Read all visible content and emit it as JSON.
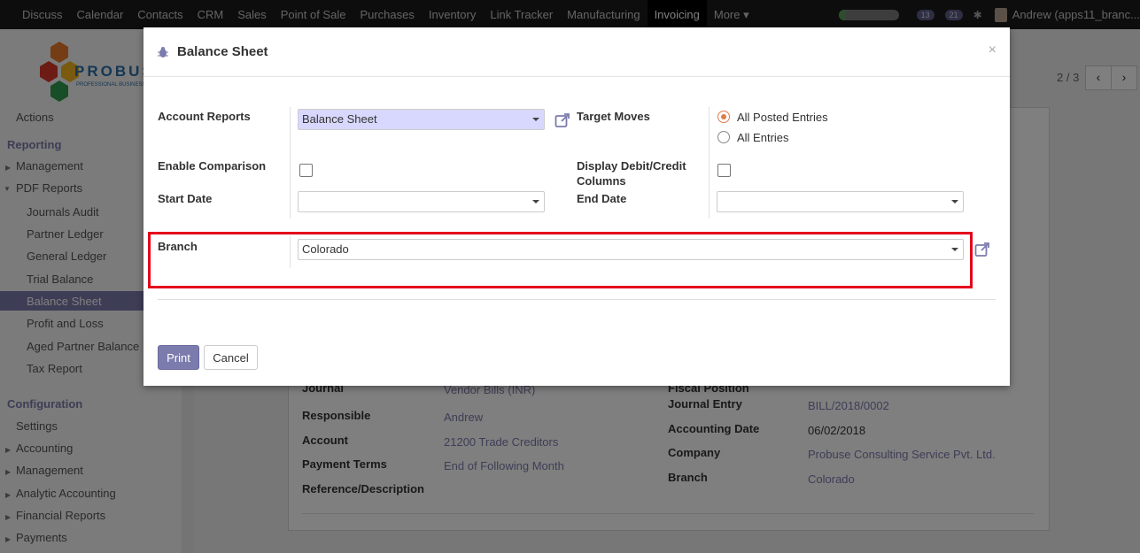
{
  "topbar": {
    "menu": [
      "Discuss",
      "Calendar",
      "Contacts",
      "CRM",
      "Sales",
      "Point of Sale",
      "Purchases",
      "Inventory",
      "Link Tracker",
      "Manufacturing",
      "Invoicing",
      "More ▾"
    ],
    "active": "Invoicing",
    "badge1": "13",
    "badge2": "21",
    "user": "Andrew (apps11_branc..."
  },
  "pager": {
    "text": "2 / 3",
    "prev": "‹",
    "next": "›"
  },
  "logo": {
    "text": "PROBUS",
    "tagline": "PROFESSIONAL BUSINESS"
  },
  "sidebar": {
    "actions": "Actions",
    "reporting": "Reporting",
    "management": "Management",
    "pdf_reports": "PDF Reports",
    "journals_audit": "Journals Audit",
    "partner_ledger": "Partner Ledger",
    "general_ledger": "General Ledger",
    "trial_balance": "Trial Balance",
    "balance_sheet": "Balance Sheet",
    "profit_loss": "Profit and Loss",
    "aged_partner": "Aged Partner Balance",
    "tax_report": "Tax Report",
    "configuration": "Configuration",
    "settings": "Settings",
    "accounting": "Accounting",
    "management2": "Management",
    "analytic": "Analytic Accounting",
    "financial": "Financial Reports",
    "payments": "Payments"
  },
  "background_form": {
    "journal_label": "Journal",
    "journal_value": "Vendor Bills (INR)",
    "fiscal_label": "Fiscal Position",
    "responsible_label": "Responsible",
    "responsible_value": "Andrew",
    "journal_entry_label": "Journal Entry",
    "journal_entry_value": "BILL/2018/0002",
    "account_label": "Account",
    "account_value": "21200 Trade Creditors",
    "accounting_date_label": "Accounting Date",
    "accounting_date_value": "06/02/2018",
    "payment_terms_label": "Payment Terms",
    "payment_terms_value": "End of Following Month",
    "company_label": "Company",
    "company_value": "Probuse Consulting Service Pvt. Ltd.",
    "reference_label": "Reference/Description",
    "branch_label": "Branch",
    "branch_value": "Colorado"
  },
  "modal": {
    "title": "Balance Sheet",
    "close": "×",
    "account_reports_label": "Account Reports",
    "account_reports_value": "Balance Sheet",
    "target_moves_label": "Target Moves",
    "radio_posted": "All Posted Entries",
    "radio_all": "All Entries",
    "enable_comparison_label": "Enable Comparison",
    "display_debit_label_1": "Display Debit/Credit",
    "display_debit_label_2": "Columns",
    "start_date_label": "Start Date",
    "start_date_value": "",
    "end_date_label": "End Date",
    "end_date_value": "",
    "branch_label": "Branch",
    "branch_value": "Colorado",
    "print_button": "Print",
    "cancel_button": "Cancel"
  },
  "colors": {
    "accent": "#7c7bad",
    "highlight_box": "#e3001b",
    "radio_on": "#e07b48"
  }
}
